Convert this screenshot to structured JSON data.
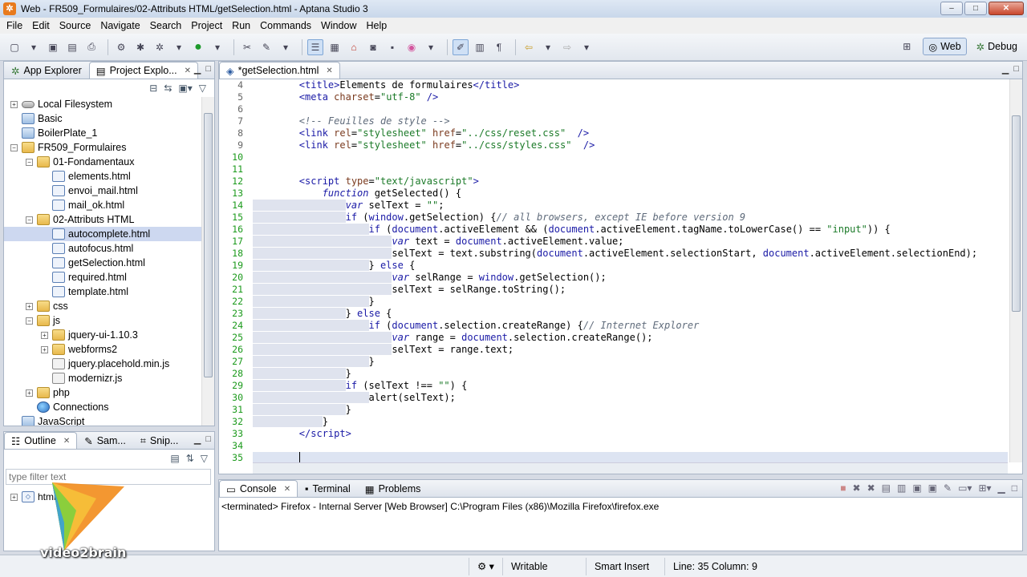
{
  "window": {
    "title": "Web - FR509_Formulaires/02-Attributs HTML/getSelection.html - Aptana Studio 3",
    "minimize": "–",
    "maximize": "□",
    "close": "✕"
  },
  "menu": [
    "File",
    "Edit",
    "Source",
    "Navigate",
    "Search",
    "Project",
    "Run",
    "Commands",
    "Window",
    "Help"
  ],
  "perspectives": {
    "web_label": "Web",
    "debug_label": "Debug"
  },
  "left_panel": {
    "tabs": [
      {
        "label": "App Explorer"
      },
      {
        "label": "Project Explo..."
      }
    ],
    "tree": [
      {
        "label": "Local Filesystem",
        "indent": 0,
        "expander": "+",
        "icon": "disk"
      },
      {
        "label": "Basic",
        "indent": 0,
        "expander": "",
        "icon": "project"
      },
      {
        "label": "BoilerPlate_1",
        "indent": 0,
        "expander": "",
        "icon": "project"
      },
      {
        "label": "FR509_Formulaires",
        "indent": 0,
        "expander": "−",
        "icon": "folder"
      },
      {
        "label": "01-Fondamentaux",
        "indent": 1,
        "expander": "−",
        "icon": "folder"
      },
      {
        "label": "elements.html",
        "indent": 2,
        "expander": "",
        "icon": "html"
      },
      {
        "label": "envoi_mail.html",
        "indent": 2,
        "expander": "",
        "icon": "html"
      },
      {
        "label": "mail_ok.html",
        "indent": 2,
        "expander": "",
        "icon": "html"
      },
      {
        "label": "02-Attributs HTML",
        "indent": 1,
        "expander": "−",
        "icon": "folder"
      },
      {
        "label": "autocomplete.html",
        "indent": 2,
        "expander": "",
        "icon": "html",
        "selected": true
      },
      {
        "label": "autofocus.html",
        "indent": 2,
        "expander": "",
        "icon": "html"
      },
      {
        "label": "getSelection.html",
        "indent": 2,
        "expander": "",
        "icon": "html"
      },
      {
        "label": "required.html",
        "indent": 2,
        "expander": "",
        "icon": "html"
      },
      {
        "label": "template.html",
        "indent": 2,
        "expander": "",
        "icon": "html"
      },
      {
        "label": "css",
        "indent": 1,
        "expander": "+",
        "icon": "folder"
      },
      {
        "label": "js",
        "indent": 1,
        "expander": "−",
        "icon": "folder"
      },
      {
        "label": "jquery-ui-1.10.3",
        "indent": 2,
        "expander": "+",
        "icon": "folder"
      },
      {
        "label": "webforms2",
        "indent": 2,
        "expander": "+",
        "icon": "folder"
      },
      {
        "label": "jquery.placehold.min.js",
        "indent": 2,
        "expander": "",
        "icon": "js"
      },
      {
        "label": "modernizr.js",
        "indent": 2,
        "expander": "",
        "icon": "js"
      },
      {
        "label": "php",
        "indent": 1,
        "expander": "+",
        "icon": "folder"
      },
      {
        "label": "Connections",
        "indent": 1,
        "expander": "",
        "icon": "globe"
      },
      {
        "label": "JavaScript",
        "indent": 0,
        "expander": "",
        "icon": "project"
      }
    ]
  },
  "outline_panel": {
    "tabs": [
      {
        "label": "Outline"
      },
      {
        "label": "Sam..."
      },
      {
        "label": "Snip..."
      }
    ],
    "filter_placeholder": "type filter text",
    "tree_item": "html"
  },
  "editor": {
    "tab_label": "*getSelection.html",
    "lines": [
      {
        "n": "4",
        "html": "        <span class='t-tag'>&lt;title&gt;</span>Elements de formulaires<span class='t-tag'>&lt;/title&gt;</span>"
      },
      {
        "n": "5",
        "html": "        <span class='t-tag'>&lt;meta</span> <span class='t-attr'>charset</span>=<span class='t-str'>\"utf-8\"</span> <span class='t-tag'>/&gt;</span>"
      },
      {
        "n": "6",
        "html": ""
      },
      {
        "n": "7",
        "html": "        <span class='t-com'>&lt;!-- Feuilles de style --&gt;</span>"
      },
      {
        "n": "8",
        "html": "        <span class='t-tag'>&lt;link</span> <span class='t-attr'>rel</span>=<span class='t-str'>\"stylesheet\"</span> <span class='t-attr'>href</span>=<span class='t-str'>\"../css/reset.css\"</span>  <span class='t-tag'>/&gt;</span>"
      },
      {
        "n": "9",
        "html": "        <span class='t-tag'>&lt;link</span> <span class='t-attr'>rel</span>=<span class='t-str'>\"stylesheet\"</span> <span class='t-attr'>href</span>=<span class='t-str'>\"../css/styles.css\"</span>  <span class='t-tag'>/&gt;</span>"
      },
      {
        "n": "10",
        "html": "",
        "mod": true
      },
      {
        "n": "11",
        "html": "",
        "mod": true
      },
      {
        "n": "12",
        "html": "        <span class='t-tag'>&lt;script</span> <span class='t-attr'>type</span>=<span class='t-str'>\"text/javascript\"</span><span class='t-tag'>&gt;</span>",
        "mod": true
      },
      {
        "n": "13",
        "html": "            <span class='t-kw'>function</span> getSelected() {",
        "mod": true
      },
      {
        "n": "14",
        "html": "<span class='sel'>                </span><span class='t-kw'>var</span> selText = <span class='t-str'>\"\"</span>;",
        "mod": true
      },
      {
        "n": "15",
        "html": "<span class='sel'>                </span><span class='t-kw' style='font-style:normal'>if</span> (<span class='t-obj'>window</span>.getSelection) {<span class='t-com'>// all browsers, except IE before version 9</span>",
        "mod": true
      },
      {
        "n": "16",
        "html": "<span class='sel'>                    </span><span class='t-kw' style='font-style:normal'>if</span> (<span class='t-obj'>document</span>.activeElement &amp;&amp; (<span class='t-obj'>document</span>.activeElement.tagName.toLowerCase() == <span class='t-str'>\"input\"</span>)) {",
        "mod": true
      },
      {
        "n": "17",
        "html": "<span class='sel'>                        </span><span class='t-kw'>var</span> text = <span class='t-obj'>document</span>.activeElement.value;",
        "mod": true
      },
      {
        "n": "18",
        "html": "<span class='sel'>                        </span>selText = text.substring(<span class='t-obj'>document</span>.activeElement.selectionStart, <span class='t-obj'>document</span>.activeElement.selectionEnd);",
        "mod": true
      },
      {
        "n": "19",
        "html": "<span class='sel'>                    </span>} <span class='t-kw' style='font-style:normal'>else</span> {",
        "mod": true
      },
      {
        "n": "20",
        "html": "<span class='sel'>                        </span><span class='t-kw'>var</span> selRange = <span class='t-obj'>window</span>.getSelection();",
        "mod": true
      },
      {
        "n": "21",
        "html": "<span class='sel'>                        </span>selText = selRange.toString();",
        "mod": true
      },
      {
        "n": "22",
        "html": "<span class='sel'>                    </span>}",
        "mod": true
      },
      {
        "n": "23",
        "html": "<span class='sel'>                </span>} <span class='t-kw' style='font-style:normal'>else</span> {",
        "mod": true
      },
      {
        "n": "24",
        "html": "<span class='sel'>                    </span><span class='t-kw' style='font-style:normal'>if</span> (<span class='t-obj'>document</span>.selection.createRange) {<span class='t-com'>// Internet Explorer</span>",
        "mod": true
      },
      {
        "n": "25",
        "html": "<span class='sel'>                        </span><span class='t-kw'>var</span> range = <span class='t-obj'>document</span>.selection.createRange();",
        "mod": true
      },
      {
        "n": "26",
        "html": "<span class='sel'>                        </span>selText = range.text;",
        "mod": true
      },
      {
        "n": "27",
        "html": "<span class='sel'>                    </span>}",
        "mod": true
      },
      {
        "n": "28",
        "html": "<span class='sel'>                </span>}",
        "mod": true
      },
      {
        "n": "29",
        "html": "<span class='sel'>                </span><span class='t-kw' style='font-style:normal'>if</span> (selText !== <span class='t-str'>\"\"</span>) {",
        "mod": true
      },
      {
        "n": "30",
        "html": "<span class='sel'>                    </span>alert(selText);",
        "mod": true
      },
      {
        "n": "31",
        "html": "<span class='sel'>                </span>}",
        "mod": true
      },
      {
        "n": "32",
        "html": "<span class='sel'>            </span>}",
        "mod": true
      },
      {
        "n": "33",
        "html": "        <span class='t-tag'>&lt;/script&gt;</span>",
        "mod": true
      },
      {
        "n": "34",
        "html": "",
        "mod": true
      },
      {
        "n": "35",
        "html": "        <span style='border-left:1px solid #000'></span>",
        "mod": true,
        "current": true
      }
    ]
  },
  "console_panel": {
    "tabs": [
      {
        "label": "Console"
      },
      {
        "label": "Terminal"
      },
      {
        "label": "Problems"
      }
    ],
    "output": "<terminated> Firefox - Internal Server [Web Browser] C:\\Program Files (x86)\\Mozilla Firefox\\firefox.exe"
  },
  "status": {
    "writable": "Writable",
    "insert_mode": "Smart Insert",
    "position": "Line: 35 Column: 9"
  },
  "watermark": {
    "brand": "video2brain"
  }
}
